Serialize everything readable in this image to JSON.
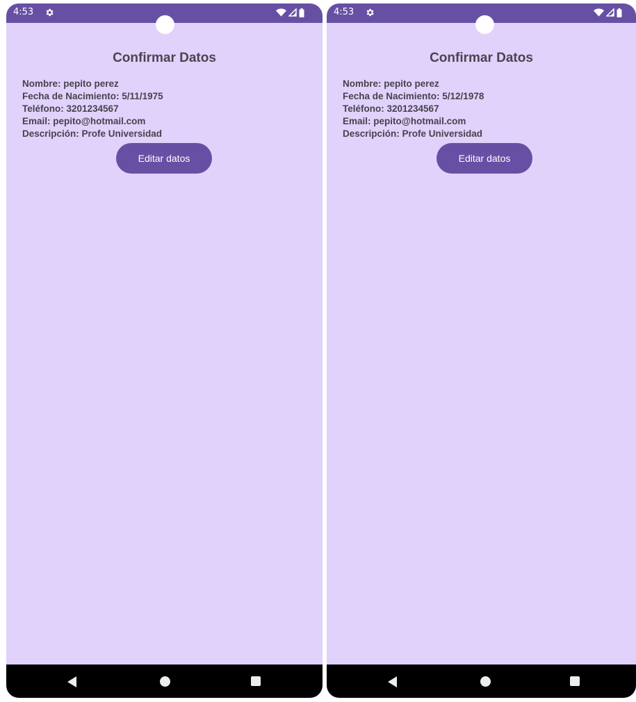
{
  "screens": [
    {
      "status": {
        "time": "4:53",
        "icons": [
          "gear-icon",
          "wifi-icon",
          "signal-icon",
          "battery-icon"
        ]
      },
      "title": "Confirmar Datos",
      "fields": {
        "nombre": "Nombre: pepito perez",
        "fecha": "Fecha de Nacimiento: 5/11/1975",
        "telefono": "Teléfono: 3201234567",
        "email": "Email: pepito@hotmail.com",
        "descripcion": "Descripción: Profe Universidad"
      },
      "edit_button_label": "Editar datos"
    },
    {
      "status": {
        "time": "4:53",
        "icons": [
          "gear-icon",
          "wifi-icon",
          "signal-icon",
          "battery-icon"
        ]
      },
      "title": "Confirmar Datos",
      "fields": {
        "nombre": "Nombre: pepito perez",
        "fecha": "Fecha de Nacimiento: 5/12/1978",
        "telefono": "Teléfono: 3201234567",
        "email": "Email: pepito@hotmail.com",
        "descripcion": "Descripción: Profe Universidad"
      },
      "edit_button_label": "Editar datos"
    }
  ],
  "colors": {
    "primary": "#6750a4",
    "background": "#e0d2fb",
    "text": "#49454f",
    "nav_bar": "#000000"
  }
}
